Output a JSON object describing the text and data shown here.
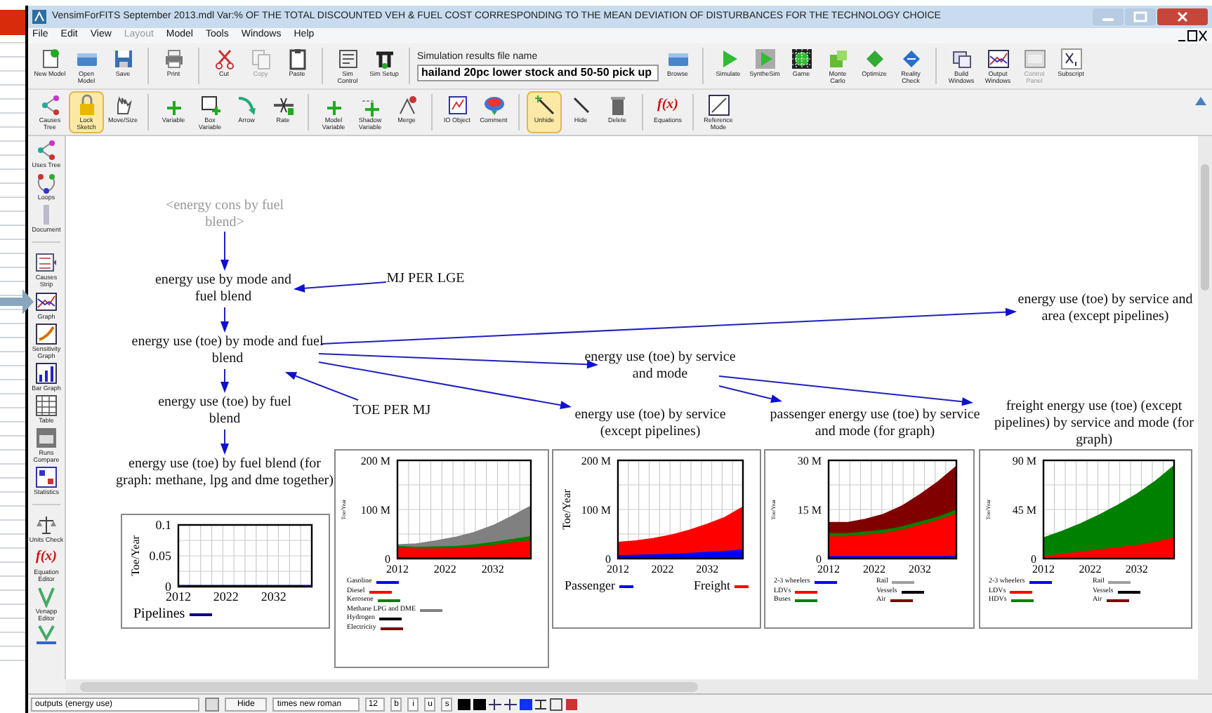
{
  "window": {
    "title": "VensimForFITS September 2013.mdl Var:% OF THE TOTAL DISCOUNTED VEH & FUEL COST CORRESPONDING TO THE MEAN DEVIATION OF DISTURBANCES FOR THE TECHNOLOGY CHOICE"
  },
  "menu": [
    {
      "label": "File",
      "disabled": false
    },
    {
      "label": "Edit",
      "disabled": false
    },
    {
      "label": "View",
      "disabled": false
    },
    {
      "label": "Layout",
      "disabled": true
    },
    {
      "label": "Model",
      "disabled": false
    },
    {
      "label": "Tools",
      "disabled": false
    },
    {
      "label": "Windows",
      "disabled": false
    },
    {
      "label": "Help",
      "disabled": false
    }
  ],
  "toolbar_top": [
    {
      "label": "New Model",
      "disabled": false
    },
    {
      "label": "Open Model",
      "disabled": false
    },
    {
      "label": "Save",
      "disabled": false
    },
    {
      "label": "Print",
      "disabled": false
    },
    {
      "label": "Cut",
      "disabled": false
    },
    {
      "label": "Copy",
      "disabled": true
    },
    {
      "label": "Paste",
      "disabled": false
    },
    {
      "label": "Sim Control",
      "disabled": false
    },
    {
      "label": "Sim Setup",
      "disabled": false
    }
  ],
  "results_file": {
    "label": "Simulation results file name",
    "value": "hailand 20pc lower stock and 50-50 pick up"
  },
  "toolbar_run": [
    {
      "label": "Browse",
      "disabled": false
    },
    {
      "label": "Simulate",
      "disabled": false
    },
    {
      "label": "SyntheSim",
      "disabled": false
    },
    {
      "label": "Game",
      "disabled": false
    },
    {
      "label": "Monte Carlo",
      "disabled": false
    },
    {
      "label": "Optimize",
      "disabled": false
    },
    {
      "label": "Reality Check",
      "disabled": false
    },
    {
      "label": "Build Windows",
      "disabled": false
    },
    {
      "label": "Output Windows",
      "disabled": false
    },
    {
      "label": "Control Panel",
      "disabled": true
    },
    {
      "label": "Subscript",
      "disabled": false
    }
  ],
  "sketch_tools": [
    {
      "label": "Causes Tree",
      "selected": false
    },
    {
      "label": "Lock Sketch",
      "selected": true
    },
    {
      "label": "Move/Size",
      "selected": false
    },
    {
      "label": "Variable",
      "selected": false
    },
    {
      "label": "Box Variable",
      "selected": false
    },
    {
      "label": "Arrow",
      "selected": false
    },
    {
      "label": "Rate",
      "selected": false
    },
    {
      "label": "Model Variable",
      "selected": false
    },
    {
      "label": "Shadow Variable",
      "selected": false
    },
    {
      "label": "Merge",
      "selected": false
    },
    {
      "label": "IO Object",
      "selected": false
    },
    {
      "label": "Comment",
      "selected": false
    },
    {
      "label": "Unhide",
      "selected": true
    },
    {
      "label": "Hide",
      "selected": false
    },
    {
      "label": "Delete",
      "selected": false
    },
    {
      "label": "Equations",
      "selected": false,
      "glyph": "f(x)"
    },
    {
      "label": "Reference Mode",
      "selected": false
    }
  ],
  "analysis_tools": [
    {
      "label": "Uses Tree"
    },
    {
      "label": "Loops"
    },
    {
      "label": "Document"
    },
    {
      "label": "Causes Strip"
    },
    {
      "label": "Graph"
    },
    {
      "label": "Sensitivity Graph"
    },
    {
      "label": "Bar Graph"
    },
    {
      "label": "Table"
    },
    {
      "label": "Runs Compare"
    },
    {
      "label": "Statistics"
    },
    {
      "label": "Units Check"
    },
    {
      "label": "Equation Editor",
      "glyph": "f(x)"
    },
    {
      "label": "Venapp Editor"
    }
  ],
  "diagram": {
    "nodes": [
      {
        "text": "<energy cons by fuel blend>",
        "kind": "shadow"
      },
      {
        "text": "energy use by mode and fuel blend",
        "kind": "variable"
      },
      {
        "text": "MJ PER LGE",
        "kind": "constant"
      },
      {
        "text": "energy use (toe) by mode and fuel blend",
        "kind": "variable"
      },
      {
        "text": "energy use (toe) by service and area (except pipelines)",
        "kind": "variable"
      },
      {
        "text": "energy use (toe) by service and mode",
        "kind": "variable"
      },
      {
        "text": "energy use (toe) by fuel blend",
        "kind": "variable"
      },
      {
        "text": "TOE PER MJ",
        "kind": "constant"
      },
      {
        "text": "energy use (toe) by service (except pipelines)",
        "kind": "variable"
      },
      {
        "text": "passenger energy use (toe) by service and mode (for graph)",
        "kind": "variable"
      },
      {
        "text": "freight energy use (toe) (except pipelines) by service and mode (for graph)",
        "kind": "variable"
      },
      {
        "text": "energy use (toe) by fuel blend (for graph: methane, lpg and dme together)",
        "kind": "variable"
      }
    ],
    "graphs": [
      {
        "chart_data": {
          "type": "line",
          "legend": "bottom",
          "ylabel": "Toe/Year",
          "x": [
            2012,
            2016,
            2020,
            2024,
            2028,
            2032,
            2036,
            2040
          ],
          "xlim": [
            2012,
            2040
          ],
          "xticks": [
            2012,
            2022,
            2032
          ],
          "ylim": [
            0,
            0.1
          ],
          "yticks": [
            0,
            0.05,
            0.1
          ],
          "series": [
            {
              "name": "Pipelines",
              "color": "#000080",
              "values": [
                0,
                0,
                0,
                0,
                0,
                0,
                0,
                0
              ]
            }
          ]
        }
      },
      {
        "chart_data": {
          "type": "area",
          "stacked": true,
          "ylabel": "Toe/Year",
          "x": [
            2012,
            2016,
            2020,
            2024,
            2028,
            2032,
            2036,
            2040
          ],
          "xlim": [
            2012,
            2040
          ],
          "xticks": [
            2012,
            2022,
            2032
          ],
          "ylim": [
            0,
            200
          ],
          "legend": "bottom",
          "yticks": [
            {
              "value": 0,
              "label": "0"
            },
            {
              "value": 100,
              "label": "100 M"
            },
            {
              "value": 200,
              "label": "200 M"
            }
          ],
          "series": [
            {
              "name": "Gasoline",
              "color": "#0000ff",
              "values": [
                4,
                4,
                4,
                4,
                4,
                4,
                4,
                4
              ]
            },
            {
              "name": "Diesel",
              "color": "#ff0000",
              "values": [
                20,
                18,
                18,
                19,
                21,
                25,
                30,
                35
              ]
            },
            {
              "name": "Kerosene",
              "color": "#008000",
              "values": [
                3,
                3,
                4,
                4,
                5,
                6,
                7,
                8
              ]
            },
            {
              "name": "Methane LPG and DME",
              "color": "#808080",
              "values": [
                1,
                5,
                10,
                16,
                23,
                32,
                45,
                60
              ]
            },
            {
              "name": "Hydrogen",
              "color": "#000000",
              "values": [
                null,
                null,
                null,
                null,
                null,
                null,
                null,
                null
              ]
            },
            {
              "name": "Electricity",
              "color": "#800000",
              "values": [
                null,
                null,
                null,
                null,
                null,
                null,
                null,
                null
              ]
            }
          ]
        }
      },
      {
        "chart_data": {
          "type": "area",
          "stacked": true,
          "ylabel": "Toe/Year",
          "x": [
            2012,
            2016,
            2020,
            2024,
            2028,
            2032,
            2036,
            2040
          ],
          "xlim": [
            2012,
            2040
          ],
          "xticks": [
            2012,
            2022,
            2032
          ],
          "ylim": [
            0,
            200
          ],
          "legend": "bottom",
          "yticks": [
            {
              "value": 0,
              "label": "0"
            },
            {
              "value": 100,
              "label": "100 M"
            },
            {
              "value": 200,
              "label": "200 M"
            }
          ],
          "series": [
            {
              "name": "Passenger",
              "color": "#0000ff",
              "values": [
                8,
                9,
                10,
                11,
                13,
                15,
                17,
                20
              ]
            },
            {
              "name": "Freight",
              "color": "#ff0000",
              "values": [
                25,
                27,
                31,
                37,
                45,
                55,
                67,
                85
              ]
            }
          ]
        }
      },
      {
        "chart_data": {
          "type": "area",
          "stacked": true,
          "ylabel": "Toe/Year",
          "x": [
            2012,
            2016,
            2020,
            2024,
            2028,
            2032,
            2036,
            2040
          ],
          "xlim": [
            2012,
            2040
          ],
          "xticks": [
            2012,
            2022,
            2032
          ],
          "ylim": [
            0,
            30
          ],
          "legend": "bottom",
          "yticks": [
            {
              "value": 0,
              "label": "0"
            },
            {
              "value": 15,
              "label": "15 M"
            },
            {
              "value": 30,
              "label": "30 M"
            }
          ],
          "series": [
            {
              "name": "2-3 wheelers",
              "color": "#0000ff",
              "values": [
                1,
                1,
                1,
                1,
                1,
                1,
                1,
                1
              ]
            },
            {
              "name": "LDVs",
              "color": "#ff0000",
              "values": [
                6,
                6,
                6.5,
                7,
                8,
                9.5,
                11,
                13
              ]
            },
            {
              "name": "Buses",
              "color": "#008000",
              "values": [
                1,
                1,
                1,
                1,
                1,
                1,
                1,
                1.2
              ]
            },
            {
              "name": "Rail",
              "color": "#a0a0a0",
              "values": [
                null,
                null,
                null,
                null,
                null,
                null,
                null,
                null
              ]
            },
            {
              "name": "Vessels",
              "color": "#000000",
              "values": [
                null,
                null,
                null,
                null,
                null,
                null,
                null,
                null
              ]
            },
            {
              "name": "Air",
              "color": "#800000",
              "values": [
                3,
                3,
                3.5,
                4.5,
                6,
                8,
                10.5,
                13
              ]
            }
          ]
        }
      },
      {
        "chart_data": {
          "type": "area",
          "stacked": true,
          "ylabel": "Toe/Year",
          "x": [
            2012,
            2016,
            2020,
            2024,
            2028,
            2032,
            2036,
            2040
          ],
          "xlim": [
            2012,
            2040
          ],
          "xticks": [
            2012,
            2022,
            2032
          ],
          "ylim": [
            0,
            90
          ],
          "legend": "bottom",
          "yticks": [
            {
              "value": 0,
              "label": "0"
            },
            {
              "value": 45,
              "label": "45 M"
            },
            {
              "value": 90,
              "label": "90 M"
            }
          ],
          "series": [
            {
              "name": "2-3 wheelers",
              "color": "#0000ff",
              "values": [
                null,
                null,
                null,
                null,
                null,
                null,
                null,
                null
              ]
            },
            {
              "name": "LDVs",
              "color": "#ff0000",
              "values": [
                3,
                5,
                7,
                9,
                11,
                13,
                16,
                20
              ]
            },
            {
              "name": "HDVs",
              "color": "#008000",
              "values": [
                16,
                20,
                25,
                31,
                38,
                46,
                55,
                65
              ]
            },
            {
              "name": "Rail",
              "color": "#a0a0a0",
              "values": [
                null,
                null,
                null,
                null,
                null,
                null,
                null,
                null
              ]
            },
            {
              "name": "Vessels",
              "color": "#000000",
              "values": [
                null,
                null,
                null,
                null,
                null,
                null,
                null,
                null
              ]
            },
            {
              "name": "Air",
              "color": "#800000",
              "values": [
                null,
                null,
                null,
                null,
                null,
                null,
                null,
                null
              ]
            }
          ]
        }
      }
    ]
  },
  "status_bar": {
    "view": "outputs (energy use)",
    "hide_button": "Hide",
    "font": "times new roman",
    "size": "12",
    "style_buttons": [
      "b",
      "i",
      "u",
      "s"
    ]
  }
}
